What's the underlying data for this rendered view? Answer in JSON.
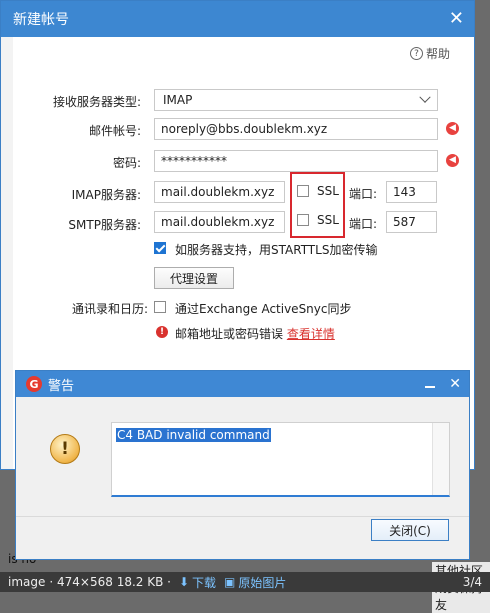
{
  "background": {
    "left_fragment": "is no",
    "status_label": "image",
    "status_size": "· 474×568 18.2 KB ·",
    "download_label": "下载",
    "original_label": "原始图片",
    "pager": "3/4",
    "right_text": "其他社区成员保持友"
  },
  "dialog": {
    "title": "新建帐号",
    "help_label": "帮助",
    "fields": {
      "server_type_label": "接收服务器类型:",
      "server_type_value": "IMAP",
      "account_label": "邮件帐号:",
      "account_value": "noreply@bbs.doublekm.xyz",
      "password_label": "密码:",
      "password_value": "***********",
      "imap_label": "IMAP服务器:",
      "imap_value": "mail.doublekm.xyz",
      "smtp_label": "SMTP服务器:",
      "smtp_value": "mail.doublekm.xyz",
      "ssl_label": "SSL",
      "port_label": "端口:",
      "imap_port": "143",
      "smtp_port": "587"
    },
    "starttls_label": "如服务器支持，用STARTTLS加密传输",
    "proxy_button": "代理设置",
    "contacts_label": "通讯录和日历:",
    "exchange_label": "通过Exchange ActiveSnyc同步",
    "error_text": "邮箱地址或密码错误",
    "error_link": "查看详情",
    "colors": {
      "title_bar": "#3d87d1",
      "error": "#d9322e",
      "ssl_highlight": "#d8282e"
    }
  },
  "warning": {
    "title": "警告",
    "message": "C4 BAD invalid command",
    "close_button": "关闭(C)"
  }
}
